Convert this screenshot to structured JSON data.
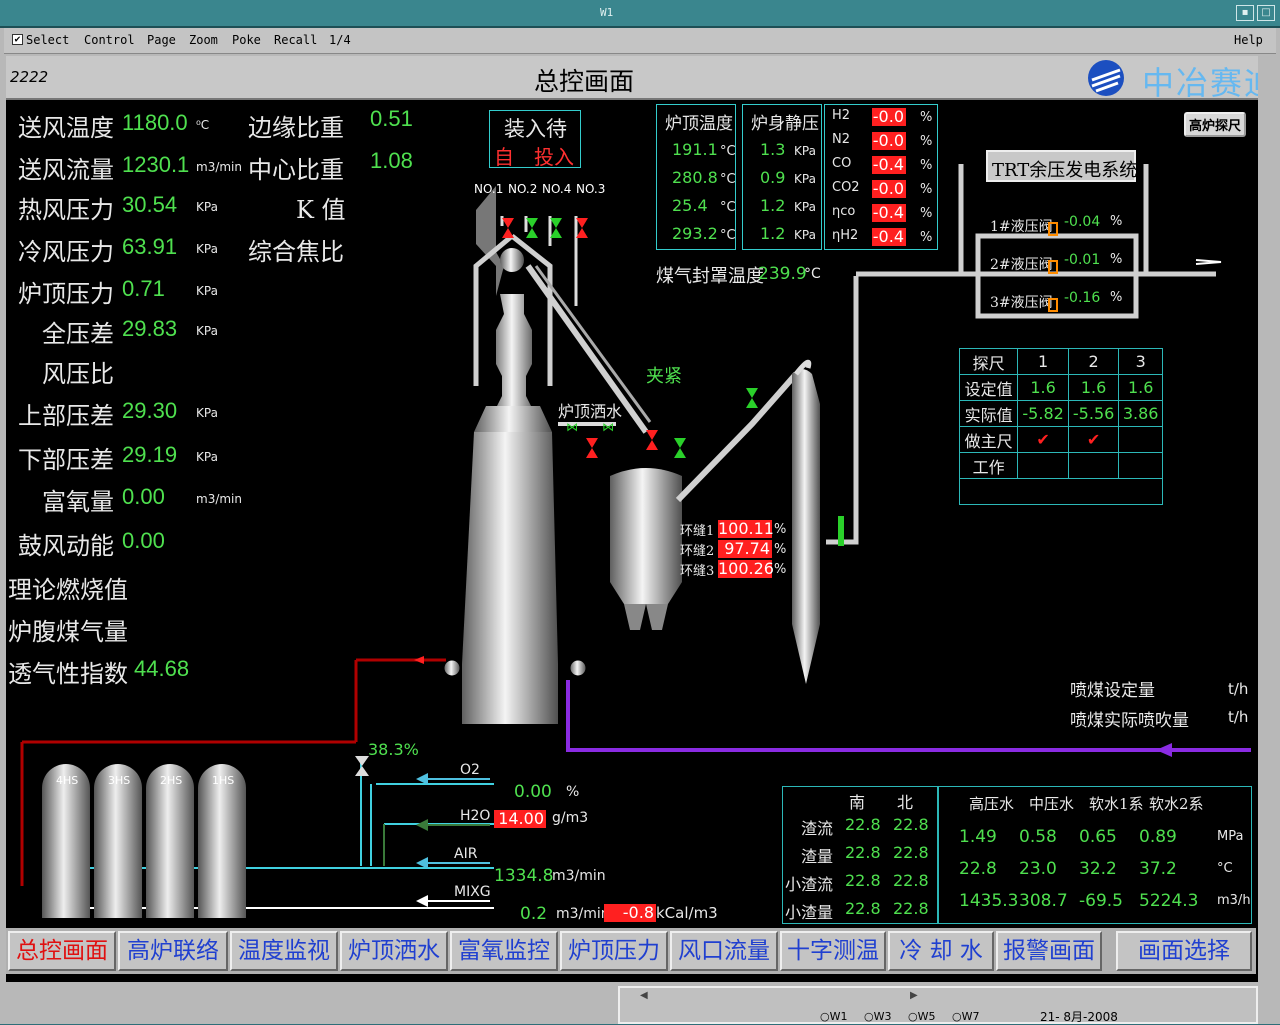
{
  "window": {
    "title": "W1"
  },
  "menu": {
    "select": "Select",
    "control": "Control",
    "page": "Page",
    "zoom": "Zoom",
    "poke": "Poke",
    "recall": "Recall",
    "pages": "1/4",
    "help": "Help"
  },
  "header": {
    "id": "2222",
    "title": "总控画面",
    "logo": "中冶赛迪"
  },
  "probe_button": "高炉探尺",
  "left_params": [
    {
      "label": "送风温度",
      "value": "1180.0",
      "unit": "⁰C"
    },
    {
      "label": "送风流量",
      "value": "1230.1",
      "unit": "m3/min"
    },
    {
      "label": "热风压力",
      "value": "30.54",
      "unit": "KPa"
    },
    {
      "label": "冷风压力",
      "value": "63.91",
      "unit": "KPa"
    },
    {
      "label": "炉顶压力",
      "value": "0.71",
      "unit": "KPa"
    },
    {
      "label": "全压差",
      "value": "29.83",
      "unit": "KPa"
    },
    {
      "label": "风压比",
      "value": "",
      "unit": ""
    },
    {
      "label": "上部压差",
      "value": "29.30",
      "unit": "KPa"
    },
    {
      "label": "下部压差",
      "value": "29.19",
      "unit": "KPa"
    },
    {
      "label": "富氧量",
      "value": "0.00",
      "unit": "m3/min"
    },
    {
      "label": "鼓风动能",
      "value": "0.00",
      "unit": ""
    },
    {
      "label": "理论燃烧值",
      "value": "",
      "unit": ""
    },
    {
      "label": "炉腹煤气量",
      "value": "",
      "unit": ""
    },
    {
      "label": "透气性指数",
      "value": "44.68",
      "unit": ""
    }
  ],
  "mid_params": [
    {
      "label": "边缘比重",
      "value": "0.51"
    },
    {
      "label": "中心比重",
      "value": "1.08"
    },
    {
      "label": "K 值",
      "value": ""
    },
    {
      "label": "综合焦比",
      "value": ""
    }
  ],
  "charging": {
    "line1": "装入待",
    "auto": "自",
    "input": "投入"
  },
  "top_valves": [
    "NO.1",
    "NO.2",
    "NO.4",
    "NO.3"
  ],
  "top_temp": {
    "title": "炉顶温度",
    "values": [
      "191.1",
      "280.8",
      "25.4",
      "293.2"
    ],
    "unit": "°C"
  },
  "shaft_press": {
    "title": "炉身静压",
    "values": [
      "1.3",
      "0.9",
      "1.2",
      "1.2"
    ],
    "unit": "KPa"
  },
  "gas": [
    {
      "name": "H2",
      "value": "-0.0"
    },
    {
      "name": "N2",
      "value": "-0.0"
    },
    {
      "name": "CO",
      "value": "-0.4"
    },
    {
      "name": "CO2",
      "value": "-0.0"
    },
    {
      "name": "ηco",
      "value": "-0.4"
    },
    {
      "name": "ηH2",
      "value": "-0.4"
    }
  ],
  "gas_unit": "%",
  "seal_temp": {
    "label": "煤气封罩温度",
    "value": "239.9",
    "unit": "°C"
  },
  "trt": {
    "title": "TRT余压发电系统",
    "valves": [
      {
        "label": "1#液压阀",
        "value": "-0.04"
      },
      {
        "label": "2#液压阀",
        "value": "-0.01"
      },
      {
        "label": "3#液压阀",
        "value": "-0.16"
      }
    ],
    "unit": "%"
  },
  "clamp": "夹紧",
  "spray": "炉顶洒水",
  "ring": [
    {
      "label": "环缝1",
      "value": "100.11"
    },
    {
      "label": "环缝2",
      "value": "97.74"
    },
    {
      "label": "环缝3",
      "value": "100.26"
    }
  ],
  "probe_table": {
    "headers": [
      "探尺",
      "1",
      "2",
      "3"
    ],
    "rows": [
      [
        "设定值",
        "1.6",
        "1.6",
        "1.6"
      ],
      [
        "实际值",
        "-5.82",
        "-5.56",
        "3.86"
      ],
      [
        "做主尺",
        "✔",
        "✔",
        ""
      ],
      [
        "工作",
        "",
        "",
        ""
      ]
    ]
  },
  "coal": {
    "set_label": "喷煤设定量",
    "actual_label": "喷煤实际喷吹量",
    "unit": "t/h"
  },
  "stoves": [
    "4HS",
    "3HS",
    "2HS",
    "1HS"
  ],
  "cold_valve_pct": "38.3",
  "mix": [
    {
      "name": "O2",
      "value": "0.00",
      "unit": "%"
    },
    {
      "name": "H2O",
      "value": "14.00",
      "unit": "g/m3"
    },
    {
      "name": "AIR",
      "value": "1334.8",
      "unit": "m3/min"
    },
    {
      "name": "MIXG",
      "value": "0.2",
      "unit": "m3/min",
      "extra": "-0.8",
      "extra_unit": "kCal/m3"
    }
  ],
  "slag": {
    "headers": [
      "南",
      "北"
    ],
    "rows": [
      {
        "label": "渣流",
        "s": "22.8",
        "n": "22.8"
      },
      {
        "label": "渣量",
        "s": "22.8",
        "n": "22.8"
      },
      {
        "label": "小渣流",
        "s": "22.8",
        "n": "22.8"
      },
      {
        "label": "小渣量",
        "s": "22.8",
        "n": "22.8"
      }
    ]
  },
  "water": {
    "headers": [
      "高压水",
      "中压水",
      "软水1系",
      "软水2系"
    ],
    "rows": [
      {
        "vals": [
          "1.49",
          "0.58",
          "0.65",
          "0.89"
        ],
        "unit": "MPa"
      },
      {
        "vals": [
          "22.8",
          "23.0",
          "32.2",
          "37.2"
        ],
        "unit": "°C"
      },
      {
        "vals": [
          "1435.3",
          "308.7",
          "-69.5",
          "5224.3"
        ],
        "unit": "m3/h"
      }
    ]
  },
  "nav": [
    "总控画面",
    "高炉联络",
    "温度监视",
    "炉顶洒水",
    "富氧监控",
    "炉顶压力",
    "风口流量",
    "十字测温",
    "冷 却 水",
    "报警画面",
    "画面选择"
  ],
  "status": {
    "windows": [
      "W1",
      "W3",
      "W5",
      "W7"
    ],
    "date": "21- 8月-2008"
  }
}
